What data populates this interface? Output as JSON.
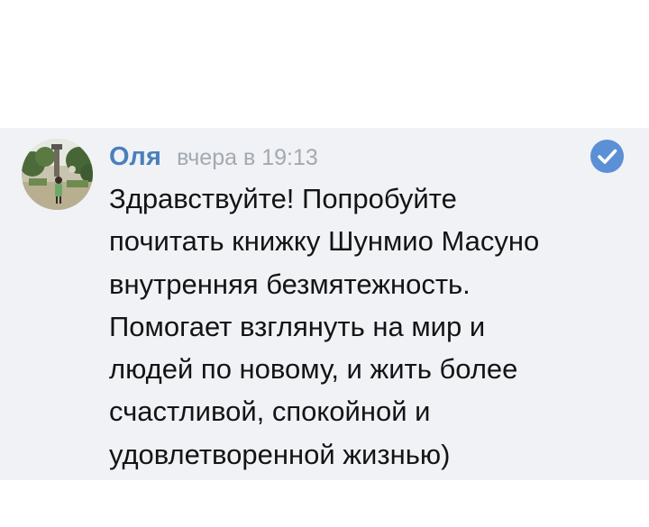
{
  "message": {
    "author": "Оля",
    "timestamp": "вчера в 19:13",
    "verified_icon": "check-circle-icon",
    "avatar_icon": "avatar-photo",
    "lines": [
      "Здравствуйте! Попробуйте",
      "почитать книжку Шунмио Масуно",
      "внутренняя безмятежность.",
      "Помогает взглянуть на мир и",
      "людей по новому, и жить более",
      "счастливой, спокойной и",
      "удовлетворенной жизнью)"
    ]
  },
  "colors": {
    "author": "#4a7fbd",
    "timestamp": "#a3a9b1",
    "text": "#141414",
    "row_background": "#f0f2f5",
    "badge": "#5b8fd6"
  }
}
